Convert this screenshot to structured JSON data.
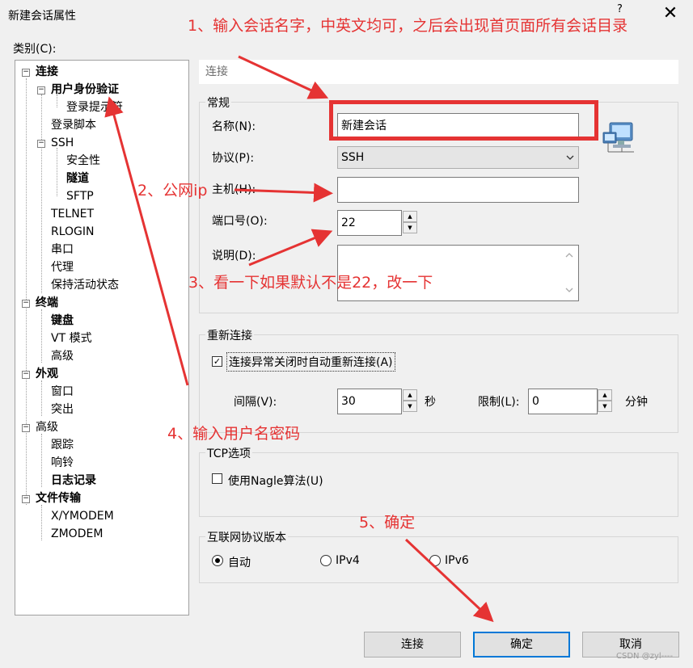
{
  "window": {
    "title": "新建会话属性",
    "help": "?",
    "close": "✕"
  },
  "category_label": "类别(C):",
  "tree": [
    {
      "label": "连接",
      "bold": true
    },
    {
      "label": "用户身份验证",
      "bold": true
    },
    {
      "label": "登录提示符",
      "bold": false
    },
    {
      "label": "登录脚本",
      "bold": false
    },
    {
      "label": "SSH",
      "bold": false
    },
    {
      "label": "安全性",
      "bold": false
    },
    {
      "label": "隧道",
      "bold": true
    },
    {
      "label": "SFTP",
      "bold": false
    },
    {
      "label": "TELNET",
      "bold": false
    },
    {
      "label": "RLOGIN",
      "bold": false
    },
    {
      "label": "串口",
      "bold": false
    },
    {
      "label": "代理",
      "bold": false
    },
    {
      "label": "保持活动状态",
      "bold": false
    },
    {
      "label": "终端",
      "bold": true
    },
    {
      "label": "键盘",
      "bold": true
    },
    {
      "label": "VT 模式",
      "bold": false
    },
    {
      "label": "高级",
      "bold": false
    },
    {
      "label": "外观",
      "bold": true
    },
    {
      "label": "窗口",
      "bold": false
    },
    {
      "label": "突出",
      "bold": false
    },
    {
      "label": "高级",
      "bold": false
    },
    {
      "label": "跟踪",
      "bold": false
    },
    {
      "label": "响铃",
      "bold": false
    },
    {
      "label": "日志记录",
      "bold": true
    },
    {
      "label": "文件传输",
      "bold": true
    },
    {
      "label": "X/YMODEM",
      "bold": false
    },
    {
      "label": "ZMODEM",
      "bold": false
    }
  ],
  "panel": {
    "header": "连接",
    "general": {
      "title": "常规",
      "name_label": "名称(N):",
      "name_value": "新建会话",
      "protocol_label": "协议(P):",
      "protocol_value": "SSH",
      "host_label": "主机(H):",
      "host_value": "",
      "port_label": "端口号(O):",
      "port_value": "22",
      "desc_label": "说明(D):",
      "desc_value": ""
    },
    "reconnect": {
      "title": "重新连接",
      "auto_label": "连接异常关闭时自动重新连接(A)",
      "auto_checked": "✓",
      "interval_label": "间隔(V):",
      "interval_value": "30",
      "interval_unit": "秒",
      "limit_label": "限制(L):",
      "limit_value": "0",
      "limit_unit": "分钟"
    },
    "tcp": {
      "title": "TCP选项",
      "nagle_label": "使用Nagle算法(U)"
    },
    "ip_version": {
      "title": "互联网协议版本",
      "options": [
        "自动",
        "IPv4",
        "IPv6"
      ]
    }
  },
  "buttons": {
    "connect": "连接",
    "ok": "确定",
    "cancel": "取消"
  },
  "annotations": {
    "a1": "1、输入会话名字，中英文均可，之后会出现首页面所有会话目录",
    "a2": "2、公网ip",
    "a3": "3、看一下如果默认不是22，改一下",
    "a4": "4、输入用户名密码",
    "a5": "5、确定"
  },
  "watermark": "CSDN @zyl----",
  "colors": {
    "annotation": "#e53333",
    "accent": "#0078d7"
  }
}
